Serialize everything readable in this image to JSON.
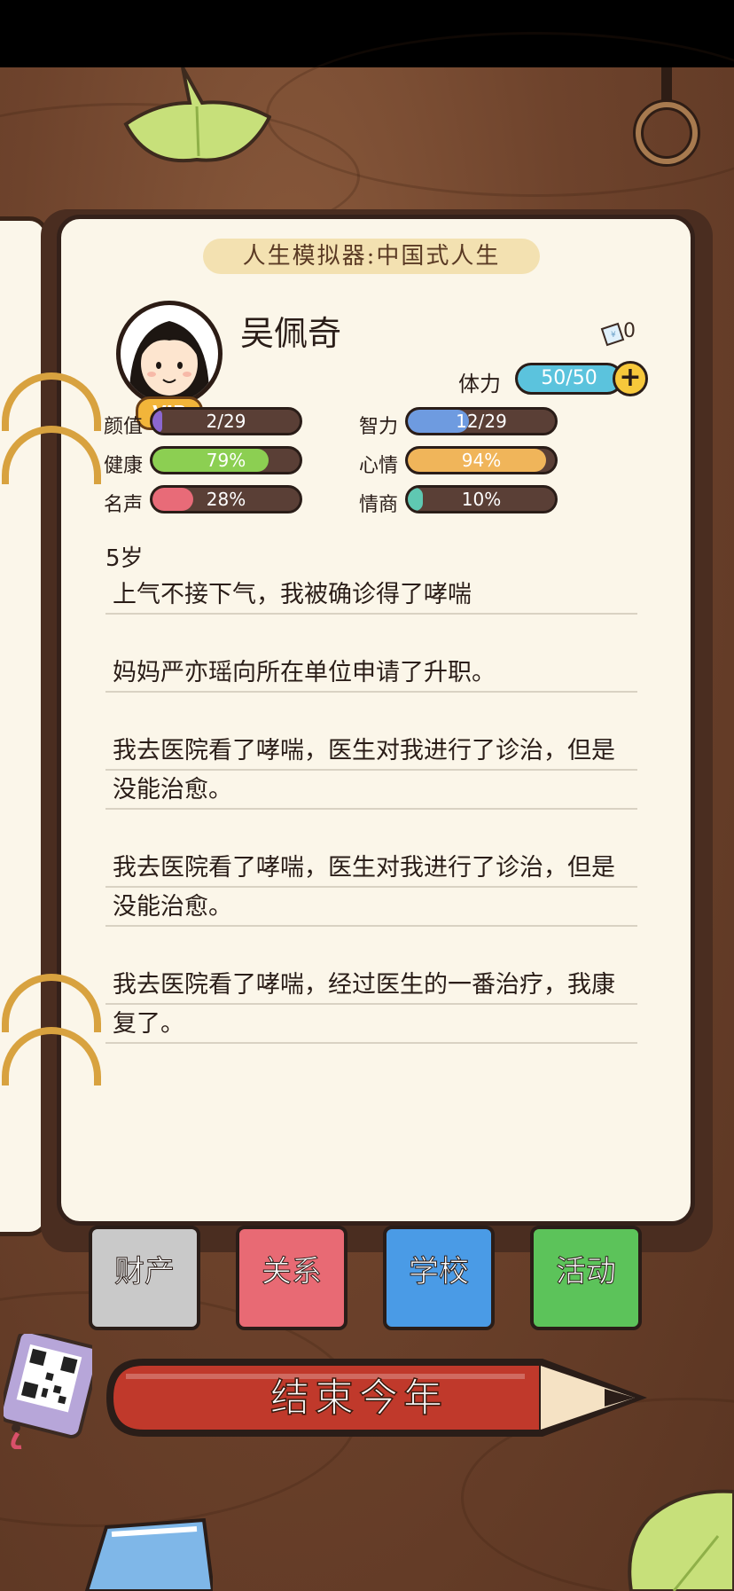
{
  "header": {
    "banner_title": "人生模拟器:中国式人生"
  },
  "profile": {
    "name": "吴佩奇",
    "vip_badge": "VIP",
    "ticket_count": "0",
    "stamina_label": "体力",
    "stamina_value": "50/50",
    "stamina_fraction": 1.0,
    "plus_symbol": "+"
  },
  "stats": [
    {
      "label": "颜值",
      "value": "2/29",
      "fraction": 0.069,
      "color": "#8b67d0"
    },
    {
      "label": "智力",
      "value": "12/29",
      "fraction": 0.414,
      "color": "#6e9be0"
    },
    {
      "label": "健康",
      "value": "79%",
      "fraction": 0.79,
      "color": "#8ccf52"
    },
    {
      "label": "心情",
      "value": "94%",
      "fraction": 0.94,
      "color": "#f0b55a"
    },
    {
      "label": "名声",
      "value": "28%",
      "fraction": 0.28,
      "color": "#e86b78"
    },
    {
      "label": "情商",
      "value": "10%",
      "fraction": 0.1,
      "color": "#5fc8b2"
    }
  ],
  "log": {
    "age": "5岁",
    "entries": [
      "上气不接下气，我被确诊得了哮喘",
      "妈妈严亦瑶向所在单位申请了升职。",
      "我去医院看了哮喘，医生对我进行了诊治，但是没能治愈。",
      "我去医院看了哮喘，医生对我进行了诊治，但是没能治愈。",
      "我去医院看了哮喘，经过医生的一番治疗，我康复了。"
    ]
  },
  "tabs": [
    {
      "label": "财产",
      "color": "#c9c9c9"
    },
    {
      "label": "关系",
      "color": "#e86a74"
    },
    {
      "label": "学校",
      "color": "#4a9be6"
    },
    {
      "label": "活动",
      "color": "#5cc35a"
    }
  ],
  "action": {
    "end_year_label": "结束今年",
    "color": "#c0392b"
  },
  "icons": [
    "ginkgo-leaf-icon",
    "ring-hook-icon",
    "ticket-icon",
    "plus-icon",
    "qr-code-icon",
    "eraser-icon",
    "pencil-icon"
  ]
}
